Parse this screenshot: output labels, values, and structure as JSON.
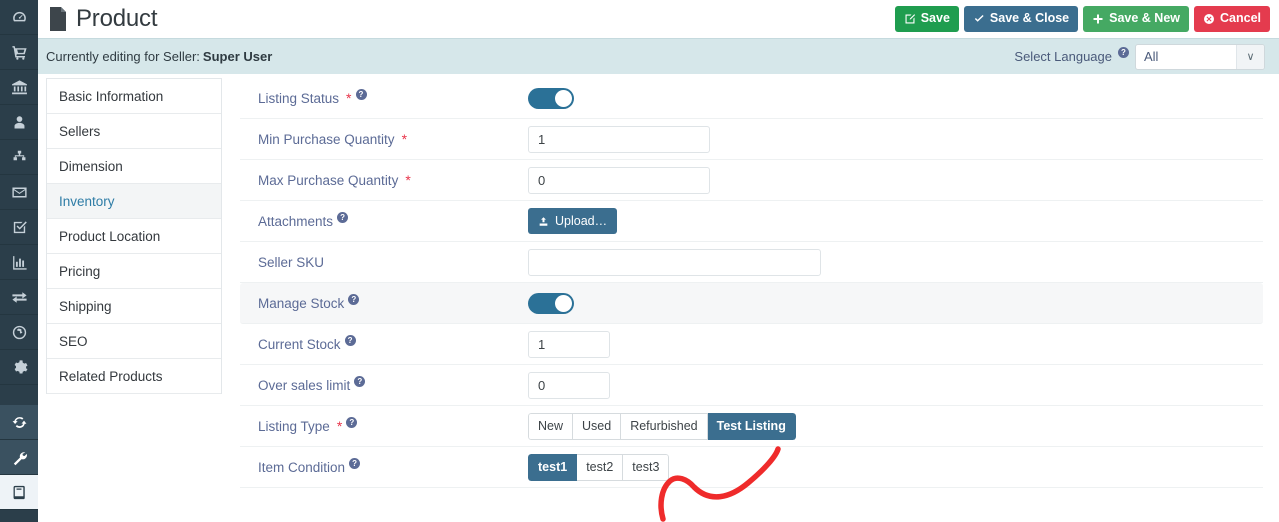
{
  "rail": {
    "items": [
      {
        "name": "dashboard-icon",
        "label": "Dashboard",
        "state": "normal"
      },
      {
        "name": "cart-icon",
        "label": "Orders",
        "state": "normal"
      },
      {
        "name": "bank-icon",
        "label": "Accounts",
        "state": "normal"
      },
      {
        "name": "user-icon",
        "label": "Customers",
        "state": "normal"
      },
      {
        "name": "sitemap-icon",
        "label": "Categories",
        "state": "normal"
      },
      {
        "name": "envelope-icon",
        "label": "Messages",
        "state": "normal"
      },
      {
        "name": "checkbox-icon",
        "label": "Tasks",
        "state": "normal"
      },
      {
        "name": "bar-chart-icon",
        "label": "Reports",
        "state": "normal"
      },
      {
        "name": "exchange-icon",
        "label": "Transactions",
        "state": "normal"
      },
      {
        "name": "globe-icon",
        "label": "Localization",
        "state": "normal"
      },
      {
        "name": "gear-icon",
        "label": "Settings",
        "state": "normal"
      },
      {
        "name": "refresh-icon",
        "label": "Sync",
        "state": "tinted"
      },
      {
        "name": "wrench-icon",
        "label": "Tools",
        "state": "tinted"
      },
      {
        "name": "book-icon",
        "label": "Catalog",
        "state": "active"
      }
    ]
  },
  "header": {
    "title": "Product",
    "doc_icon": "document-icon",
    "buttons": [
      {
        "id": "save",
        "label": "Save",
        "icon": "edit-square-icon",
        "color": "#1f9d4f"
      },
      {
        "id": "save-close",
        "label": "Save & Close",
        "icon": "check-icon",
        "color": "#3b6e8f"
      },
      {
        "id": "save-new",
        "label": "Save & New",
        "icon": "plus-icon",
        "color": "#45a963"
      },
      {
        "id": "cancel",
        "label": "Cancel",
        "icon": "circle-x-icon",
        "color": "#e43b4e"
      }
    ]
  },
  "seller_bar": {
    "prefix": "Currently editing for Seller:",
    "seller_name": "Super User",
    "language_label": "Select Language",
    "language_help": "?",
    "language_value": "All",
    "language_caret": "∨"
  },
  "nav": {
    "items": [
      {
        "label": "Basic Information",
        "active": false
      },
      {
        "label": "Sellers",
        "active": false
      },
      {
        "label": "Dimension",
        "active": false
      },
      {
        "label": "Inventory",
        "active": true
      },
      {
        "label": "Product Location",
        "active": false
      },
      {
        "label": "Pricing",
        "active": false
      },
      {
        "label": "Shipping",
        "active": false
      },
      {
        "label": "SEO",
        "active": false
      },
      {
        "label": "Related Products",
        "active": false
      }
    ]
  },
  "form": {
    "listing_status": {
      "label": "Listing Status",
      "required": true,
      "help": "?",
      "toggle_on": true
    },
    "min_purchase_quantity": {
      "label": "Min Purchase Quantity",
      "required": true,
      "value": "1"
    },
    "max_purchase_quantity": {
      "label": "Max Purchase Quantity",
      "required": true,
      "value": "0"
    },
    "attachments": {
      "label": "Attachments",
      "help": "?",
      "button_label": "Upload…",
      "button_icon": "upload-icon"
    },
    "seller_sku": {
      "label": "Seller SKU",
      "value": "",
      "placeholder": ""
    },
    "manage_stock": {
      "label": "Manage Stock",
      "help": "?",
      "toggle_on": true
    },
    "current_stock": {
      "label": "Current Stock",
      "help": "?",
      "value": "1"
    },
    "over_sales_limit": {
      "label": "Over sales limit",
      "help": "?",
      "value": "0"
    },
    "listing_type": {
      "label": "Listing Type",
      "required": true,
      "help": "?",
      "options": [
        "New",
        "Used",
        "Refurbished",
        "Test Listing"
      ],
      "selected": "Test Listing"
    },
    "item_condition": {
      "label": "Item Condition",
      "help": "?",
      "options": [
        "test1",
        "test2",
        "test3"
      ],
      "selected": "test1"
    }
  },
  "annotation": {
    "name": "red-arrow-annotation",
    "color": "#ef2b2b"
  },
  "colors": {
    "rail_bg": "#2b3e4a",
    "banner_bg": "#d6e7ea",
    "accent_teal": "#3b6e8f",
    "toggle_on": "#2b7197",
    "label_text": "#5c6b96",
    "required_red": "#e8344a"
  }
}
